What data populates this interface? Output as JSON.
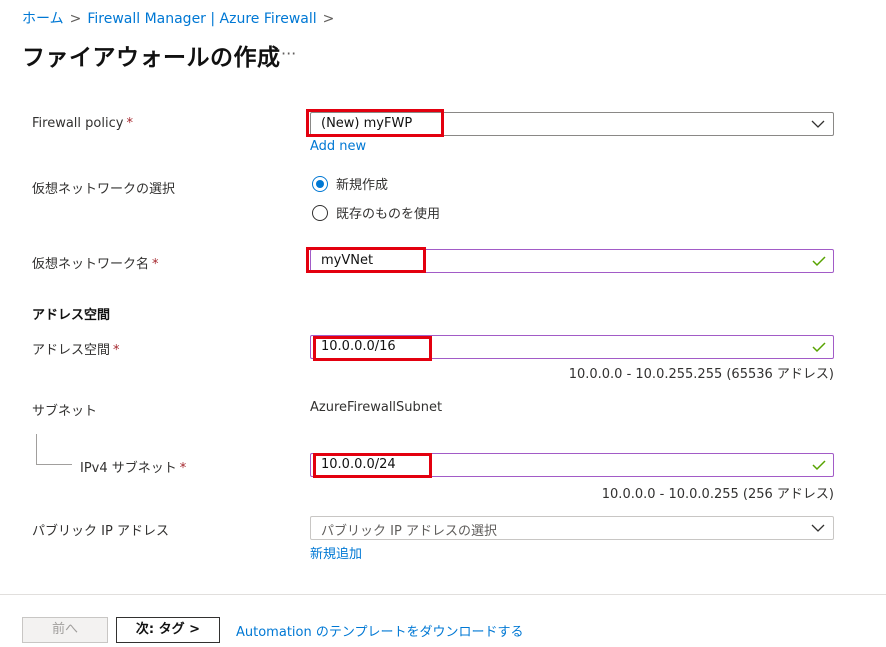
{
  "breadcrumb": {
    "home": "ホーム",
    "sep1": ">",
    "manager": "Firewall Manager | Azure Firewall",
    "sep2": ">"
  },
  "page": {
    "title": "ファイアウォールの作成",
    "more": "···"
  },
  "form": {
    "firewall_policy": {
      "label": "Firewall policy",
      "required": "*",
      "value": "(New) myFWP",
      "add_link": "Add new"
    },
    "vnet_choice": {
      "label": "仮想ネットワークの選択",
      "options": [
        "新規作成",
        "既存のものを使用"
      ],
      "selected": "新規作成"
    },
    "vnet_name": {
      "label": "仮想ネットワーク名",
      "required": "*",
      "value": "myVNet"
    },
    "address_section": {
      "heading": "アドレス空間"
    },
    "address_space": {
      "label": "アドレス空間",
      "required": "*",
      "value": "10.0.0.0/16",
      "range": "10.0.0.0 - 10.0.255.255 (65536 アドレス)"
    },
    "subnet": {
      "label": "サブネット",
      "value": "AzureFirewallSubnet"
    },
    "ipv4_subnet": {
      "label": "IPv4 サブネット",
      "required": "*",
      "value": "10.0.0.0/24",
      "range": "10.0.0.0 - 10.0.0.255 (256 アドレス)"
    },
    "public_ip": {
      "label": "パブリック IP アドレス",
      "placeholder": "パブリック IP アドレスの選択",
      "add_link": "新規追加"
    }
  },
  "footer": {
    "prev_label": "前へ",
    "next_label": "次: タグ >",
    "automation_link": "Automation のテンプレートをダウンロードする"
  },
  "colors": {
    "accent": "#0078d4",
    "highlight": "#e3000f",
    "valid_border": "#a25bc7",
    "check": "#57a300"
  }
}
